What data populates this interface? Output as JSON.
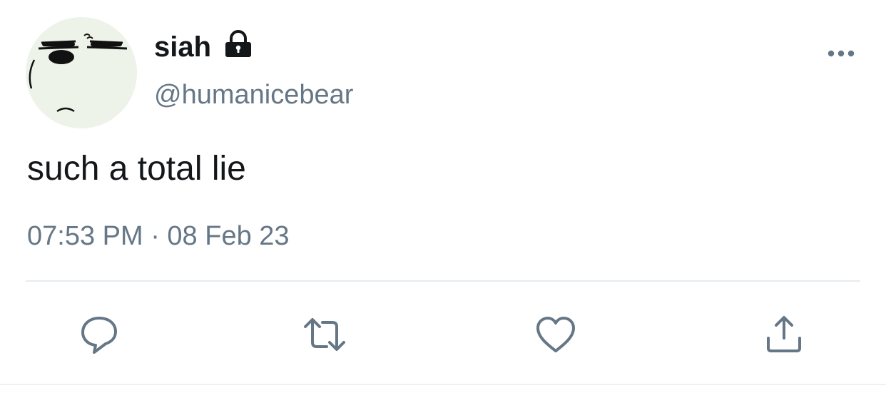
{
  "tweet": {
    "display_name": "siah",
    "handle": "@humanicebear",
    "text": "such a total lie",
    "timestamp": "07:53 PM · 08 Feb 23"
  },
  "icons": {
    "lock": "lock-icon",
    "more": "more-horizontal-icon",
    "reply": "reply-bubble-icon",
    "retweet": "retweet-icon",
    "like": "heart-icon",
    "share": "share-upload-icon"
  },
  "colors": {
    "text_primary": "#14171a",
    "text_secondary": "#657786",
    "icon_gray": "#657786",
    "divider": "#e6ecf0"
  }
}
